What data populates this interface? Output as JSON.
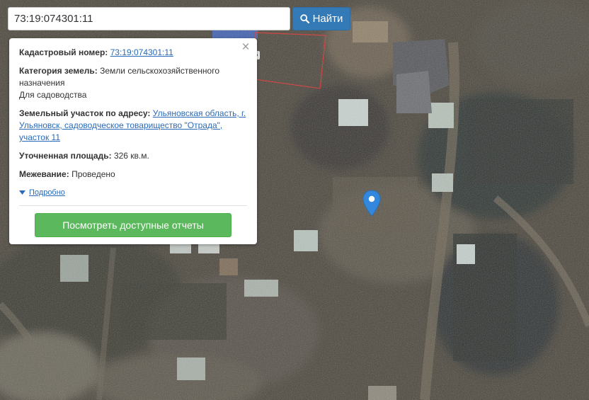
{
  "search": {
    "value": "73:19:074301:11",
    "button_label": "Найти",
    "button_icon": "search-icon"
  },
  "popup": {
    "close_icon": "close-icon",
    "cadastral": {
      "label": "Кадастровый номер:",
      "value": "73:19:074301:11"
    },
    "category": {
      "label": "Категория земель:",
      "value": "Земли сельскохозяйственного назначения",
      "use": "Для садоводства"
    },
    "address": {
      "label": "Земельный участок по адресу:",
      "value": "Ульяновская область, г. Ульяновск, садоводческое товарищество \"Отрада\", участок 11"
    },
    "area": {
      "label": "Уточненная площадь:",
      "value": "326 кв.м."
    },
    "survey": {
      "label": "Межевание:",
      "value": "Проведено"
    },
    "more_label": "Подробно",
    "reports_button": "Посмотреть доступные отчеты"
  },
  "map": {
    "marker_icon": "map-marker-icon",
    "marker_color": "#3388dd",
    "parcel_label": "5",
    "parcel_outline_color": "#d32f2f"
  },
  "colors": {
    "search_button": "#337ab7",
    "reports_button": "#5cb85c",
    "link": "#2a6ab8"
  }
}
